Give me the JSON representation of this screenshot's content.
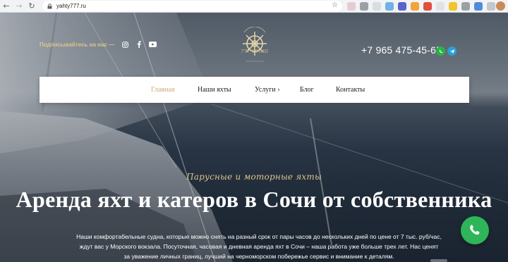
{
  "browser": {
    "url": "yahty777.ru"
  },
  "header": {
    "subscribe_text": "Подписывайтесь на нас —",
    "logo_text": "777 SOCHI",
    "phone": "+7 965 475-45-65"
  },
  "nav": {
    "items": [
      {
        "label": "Главная",
        "active": true
      },
      {
        "label": "Наши яхты",
        "active": false
      },
      {
        "label": "Услуги ›",
        "active": false
      },
      {
        "label": "Блог",
        "active": false
      },
      {
        "label": "Контакты",
        "active": false
      }
    ]
  },
  "hero": {
    "tagline": "Парусные и моторные яхты",
    "headline": "Аренда яхт и катеров в Сочи от собственника",
    "body": "Наши комфортабельные судна, которые можно снять на разный срок от пары часов до нескольких дней по цене от 7 тыс. руб/час, ждут вас у Морского вокзала. Посуточная, часовая и дневная аренда яхт в Сочи – наша работа уже больше трех лет. Нас ценят за уважение личных границ, лучший на черноморском побережье сервис и внимание к деталям."
  },
  "colors": {
    "accent_gold": "#d9c38a",
    "whatsapp_green": "#26b544",
    "telegram_blue": "#2aa0da",
    "call_button": "#2fb559"
  },
  "icons": {
    "social": [
      "instagram-icon",
      "facebook-icon",
      "youtube-icon"
    ],
    "messengers": [
      "whatsapp-icon",
      "telegram-icon"
    ],
    "call": "phone-icon"
  }
}
